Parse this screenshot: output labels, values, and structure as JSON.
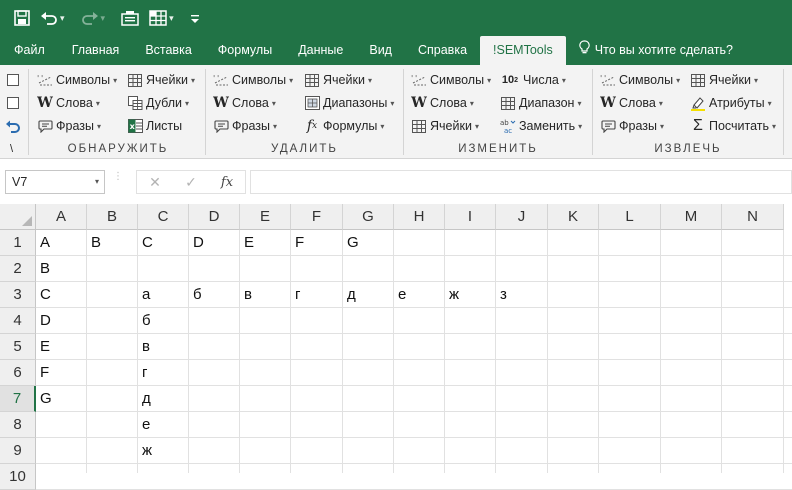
{
  "quick_access": {
    "icons": [
      "save-icon",
      "undo-icon",
      "redo-icon",
      "camera-icon",
      "table-icon",
      "customize-icon"
    ]
  },
  "tabs": [
    {
      "label": "Файл",
      "active": false
    },
    {
      "label": "Главная",
      "active": false
    },
    {
      "label": "Вставка",
      "active": false
    },
    {
      "label": "Формулы",
      "active": false
    },
    {
      "label": "Данные",
      "active": false
    },
    {
      "label": "Вид",
      "active": false
    },
    {
      "label": "Справка",
      "active": false
    },
    {
      "label": "!SEMTools",
      "active": true
    }
  ],
  "tell_me": "Что вы хотите сделать?",
  "ribbon": {
    "groups": {
      "detect": {
        "label": "ОБНАРУЖИТЬ",
        "items": {
          "symbols": "Символы",
          "words": "Слова",
          "phrases": "Фразы",
          "cells": "Ячейки",
          "duplicates": "Дубли",
          "sheets": "Листы"
        }
      },
      "remove": {
        "label": "УДАЛИТЬ",
        "items": {
          "symbols": "Символы",
          "words": "Слова",
          "phrases": "Фразы",
          "cells": "Ячейки",
          "ranges": "Диапазоны",
          "formulas": "Формулы"
        }
      },
      "change": {
        "label": "ИЗМЕНИТЬ",
        "items": {
          "symbols": "Символы",
          "words": "Слова",
          "cells": "Ячейки",
          "numbers": "Числа",
          "range": "Диапазон",
          "replace": "Заменить"
        }
      },
      "extract": {
        "label": "ИЗВЛЕЧЬ",
        "items": {
          "symbols": "Символы",
          "words": "Слова",
          "phrases": "Фразы",
          "cells": "Ячейки",
          "attributes": "Атрибуты",
          "count": "Посчитать"
        }
      }
    },
    "left_strip": {
      "backslash": "\\"
    }
  },
  "formula_bar": {
    "name_box": "V7",
    "cancel": "✕",
    "enter": "✓",
    "fx": "fx",
    "value": ""
  },
  "columns": [
    "A",
    "B",
    "C",
    "D",
    "E",
    "F",
    "G",
    "H",
    "I",
    "J",
    "K",
    "L",
    "M",
    "N"
  ],
  "rows": [
    "1",
    "2",
    "3",
    "4",
    "5",
    "6",
    "7",
    "8",
    "9",
    "10"
  ],
  "selected_row": "7",
  "cells": {
    "A1": "A",
    "B1": "B",
    "C1": "C",
    "D1": "D",
    "E1": "E",
    "F1": "F",
    "G1": "G",
    "A2": "B",
    "A3": "C",
    "C3": "а",
    "D3": "б",
    "E3": "в",
    "F3": "г",
    "G3": "д",
    "H3": "е",
    "I3": "ж",
    "J3": "з",
    "A4": "D",
    "C4": "б",
    "A5": "E",
    "C5": "в",
    "A6": "F",
    "C6": "г",
    "A7": "G",
    "C7": "д",
    "C8": "е",
    "C9": "ж"
  },
  "colors": {
    "accent": "#217346",
    "ribbon_bg": "#f3f3f3",
    "header_bg": "#efefef"
  }
}
